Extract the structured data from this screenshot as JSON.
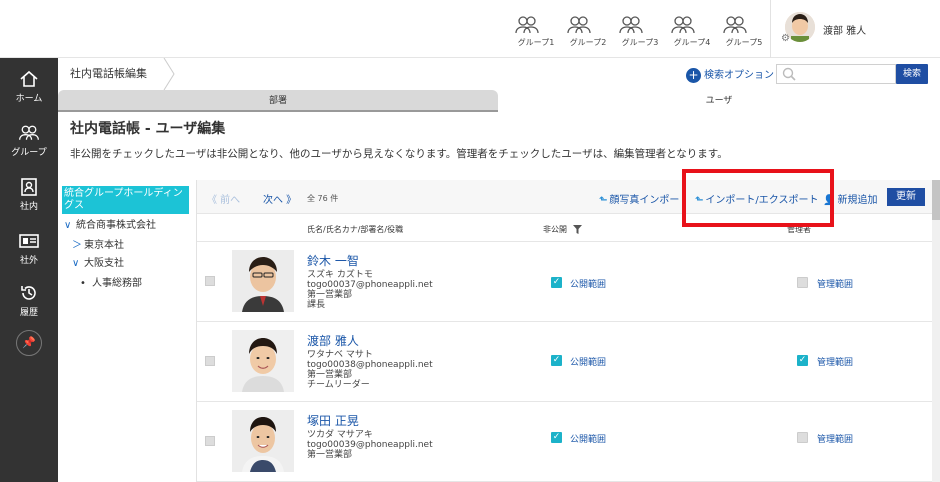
{
  "header": {
    "groups": [
      "グループ1",
      "グループ2",
      "グループ3",
      "グループ4",
      "グループ5"
    ],
    "user_name": "渡部 雅人"
  },
  "sidebar": {
    "items": [
      {
        "label": "ホーム",
        "icon": "home-icon"
      },
      {
        "label": "グループ",
        "icon": "group-icon"
      },
      {
        "label": "社内",
        "icon": "directory-icon"
      },
      {
        "label": "社外",
        "icon": "contact-card-icon"
      },
      {
        "label": "履歴",
        "icon": "history-icon"
      }
    ],
    "pin_icon": "pin-icon"
  },
  "breadcrumb": {
    "label": "社内電話帳編集"
  },
  "search": {
    "option_label": "検索オプション",
    "placeholder": "",
    "button_label": "検索"
  },
  "tabs": {
    "dept": "部署",
    "user": "ユーザ"
  },
  "page": {
    "title": "社内電話帳 - ユーザ編集",
    "description": "非公開をチェックしたユーザは非公開となり、他のユーザから見えなくなります。管理者をチェックしたユーザは、編集管理者となります。"
  },
  "tree": {
    "selected": "統合グループホールディングス",
    "items": [
      {
        "toggle": "∨",
        "label": "統合商事株式会社"
      },
      {
        "toggle": "＞",
        "label": "東京本社"
      },
      {
        "toggle": "∨",
        "label": "大阪支社"
      },
      {
        "toggle": "•",
        "label": "人事総務部"
      }
    ]
  },
  "toolbar": {
    "prev": "《 前へ",
    "next": "次へ 》",
    "count": "全 76 件",
    "photo_import": "顔写真インポー",
    "import_export": "インポート/エクスポート",
    "add_new": "新規追加",
    "refresh": "更新"
  },
  "columns": {
    "name": "氏名/氏名カナ/部署名/役職",
    "private": "非公開",
    "admin": "管理者"
  },
  "rows": [
    {
      "name": "鈴木 一智",
      "kana": "スズキ カズトモ",
      "email": "togo00037@phoneappli.net",
      "dept": "第一営業部",
      "title": "課長",
      "private": true,
      "private_label": "公開範囲",
      "admin": false,
      "admin_label": "管理範囲"
    },
    {
      "name": "渡部 雅人",
      "kana": "ワタナベ マサト",
      "email": "togo00038@phoneappli.net",
      "dept": "第一営業部",
      "title": "チームリーダー",
      "private": true,
      "private_label": "公開範囲",
      "admin": true,
      "admin_label": "管理範囲"
    },
    {
      "name": "塚田 正晃",
      "kana": "ツカダ マサアキ",
      "email": "togo00039@phoneappli.net",
      "dept": "第一営業部",
      "title": "",
      "private": true,
      "private_label": "公開範囲",
      "admin": false,
      "admin_label": "管理範囲"
    }
  ],
  "colors": {
    "accent": "#1cc3d6",
    "primary_button": "#1f4ea3",
    "link": "#1a56a8",
    "sidebar": "#333333",
    "highlight": "#e8121a"
  }
}
